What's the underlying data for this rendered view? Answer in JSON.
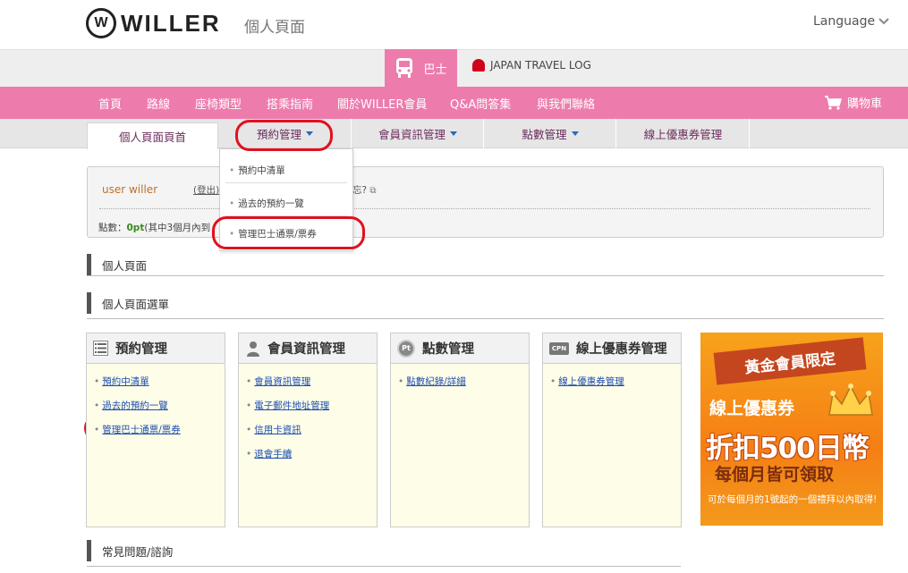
{
  "header": {
    "logo_mark": "W",
    "logo_text": "WILLER",
    "page_label": "個人頁面",
    "language_label": "Language"
  },
  "service_bar": {
    "bus_label": "巴士",
    "jtl_label": "JAPAN TRAVEL LOG"
  },
  "main_nav": {
    "items": [
      "首頁",
      "路線",
      "座椅類型",
      "搭乘指南",
      "關於WILLER會員",
      "Q&A問答集",
      "與我們聯絡"
    ],
    "cart_label": "購物車"
  },
  "sub_tabs": [
    "個人頁面頁首",
    "預約管理",
    "會員資訊管理",
    "點數管理",
    "線上優惠券管理"
  ],
  "dropdown": {
    "items": [
      "預約中清單",
      "過去的預約一覽",
      "管理巴士通票/票券"
    ]
  },
  "user": {
    "name": "user willer",
    "logout_label": "(登出)",
    "hint_text": "忘?",
    "points_label": "點數：",
    "points_value": "0pt",
    "points_note": "(其中3個月內到"
  },
  "sections": {
    "personal_page": "個人頁面",
    "menu": "個人頁面選單",
    "faq": "常見問題/諮詢"
  },
  "cards": [
    {
      "title": "預約管理",
      "icon": "list-icon",
      "links": [
        "預約中清單",
        "過去的預約一覽",
        "管理巴士通票/票券"
      ]
    },
    {
      "title": "會員資訊管理",
      "icon": "person-icon",
      "links": [
        "會員資訊管理",
        "電子郵件地址管理",
        "信用卡資訊",
        "退會手續"
      ]
    },
    {
      "title": "點數管理",
      "icon": "pt-icon",
      "icon_text": "Pt",
      "links": [
        "點數紀錄/詳細"
      ]
    },
    {
      "title": "線上優惠券管理",
      "icon": "cpn-icon",
      "icon_text": "CPN",
      "links": [
        "線上優惠券管理"
      ]
    }
  ],
  "banner": {
    "ribbon": "黃金會員限定",
    "line1": "線上優惠券",
    "line2": "折扣500日幣",
    "line3": "每個月皆可領取",
    "line4": "可於每個月的1號起的一個禮拜以內取得!"
  },
  "colors": {
    "brand_pink": "#ed7cad",
    "highlight_red": "#e0111f",
    "tab_text": "#6b2d5c"
  }
}
